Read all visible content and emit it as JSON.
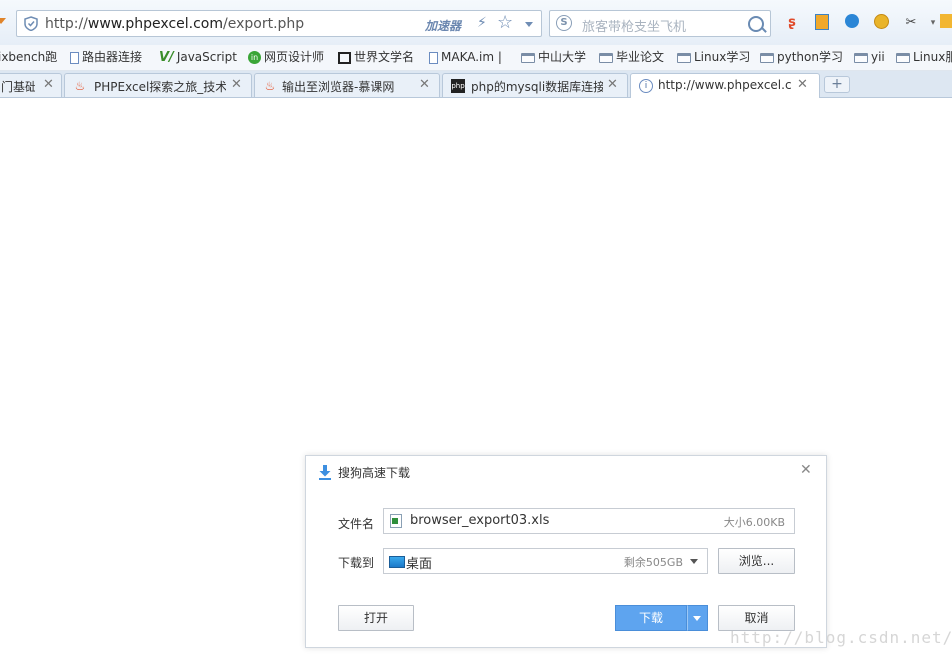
{
  "address_bar": {
    "url_prefix": "http://",
    "url_domain": "www.phpexcel.com",
    "url_path": "/export.php",
    "accelerator_label": "加速器"
  },
  "search": {
    "placeholder": "旅客带枪支坐飞机"
  },
  "bookmarks": [
    {
      "label": "ixbench跑",
      "icon": "none"
    },
    {
      "label": "路由器连接",
      "icon": "page-icon"
    },
    {
      "label": "JavaScript",
      "icon": "js-icon"
    },
    {
      "label": "网页设计师",
      "icon": "green-circle-icon"
    },
    {
      "label": "世界文学名",
      "icon": "book-icon"
    },
    {
      "label": "MAKA.im |",
      "icon": "page-icon"
    },
    {
      "label": "中山大学",
      "icon": "folder-icon"
    },
    {
      "label": "毕业论文",
      "icon": "folder-icon"
    },
    {
      "label": "Linux学习",
      "icon": "folder-icon"
    },
    {
      "label": "python学习",
      "icon": "folder-icon"
    },
    {
      "label": "yii",
      "icon": "folder-icon"
    },
    {
      "label": "Linux服",
      "icon": "folder-icon"
    }
  ],
  "tabs": [
    {
      "label": "门基础到",
      "icon": "none",
      "active": false
    },
    {
      "label": "PHPExcel探索之旅_技术",
      "icon": "flame-icon",
      "active": false
    },
    {
      "label": "输出至浏览器-慕课网",
      "icon": "flame-icon",
      "active": false
    },
    {
      "label": "php的mysqli数据库连接",
      "icon": "php-icon",
      "active": false
    },
    {
      "label": "http://www.phpexcel.co",
      "icon": "info-globe-icon",
      "active": true
    }
  ],
  "new_tab_label": "+",
  "dialog": {
    "title": "搜狗高速下载",
    "filename_label": "文件名",
    "filename": "browser_export03.xls",
    "filesize": "大小6.00KB",
    "save_to_label": "下载到",
    "save_location": "桌面",
    "free_space": "剩余505GB",
    "browse_button": "浏览...",
    "open_button": "打开",
    "download_button": "下载",
    "cancel_button": "取消"
  },
  "watermark": "http://blog.csdn.net/",
  "colors": {
    "accent": "#5ea4ef",
    "toolbar_bg": "#e6eef7",
    "tab_bar_bg": "#dde7f2"
  }
}
